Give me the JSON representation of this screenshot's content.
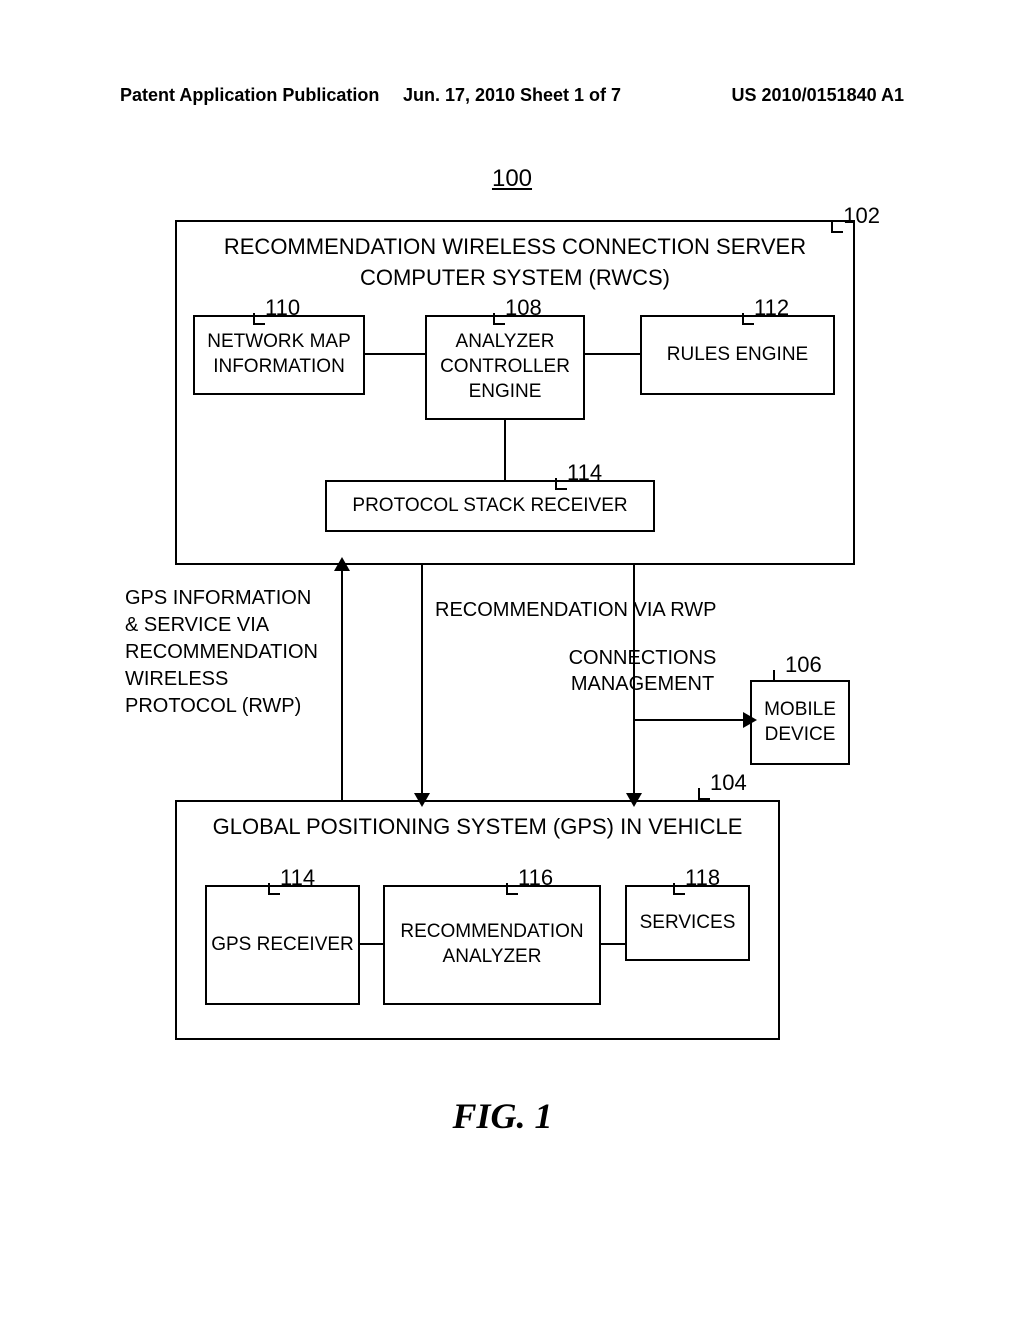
{
  "header": {
    "left": "Patent Application Publication",
    "center": "Jun. 17, 2010  Sheet 1 of 7",
    "right": "US 2010/0151840 A1"
  },
  "figure_number": "100",
  "rwcs": {
    "title_line1": "RECOMMENDATION WIRELESS CONNECTION SERVER",
    "title_line2": "COMPUTER SYSTEM (RWCS)",
    "network_map": "NETWORK MAP INFORMATION",
    "analyzer": "ANALYZER CONTROLLER ENGINE",
    "rules": "RULES ENGINE",
    "protocol_stack": "PROTOCOL STACK RECEIVER"
  },
  "labels": {
    "gps_info": "GPS INFORMATION & SERVICE VIA RECOMMENDATION WIRELESS PROTOCOL (RWP)",
    "recommendation": "RECOMMENDATION VIA RWP",
    "connections": "CONNECTIONS MANAGEMENT"
  },
  "mobile_device": "MOBILE DEVICE",
  "gps": {
    "title": "GLOBAL POSITIONING SYSTEM (GPS) IN VEHICLE",
    "receiver": "GPS RECEIVER",
    "analyzer": "RECOMMENDATION ANALYZER",
    "services": "SERVICES"
  },
  "refs": {
    "r102": "102",
    "r104": "104",
    "r106": "106",
    "r108": "108",
    "r110": "110",
    "r112": "112",
    "r114": "114",
    "r116": "116",
    "r118": "118"
  },
  "caption": "FIG. 1"
}
